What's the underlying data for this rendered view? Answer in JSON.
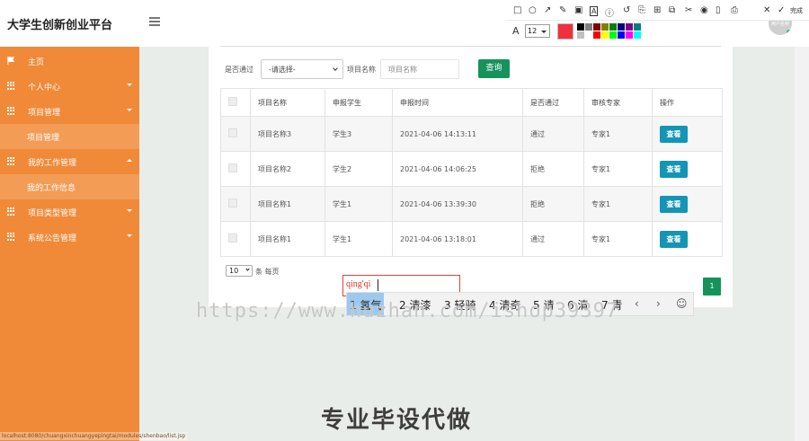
{
  "brand": "大学生创新创业平台",
  "status_url": "localhost:8080/chuangxinchuangyepingtai/modules/shenbao/list.jsp",
  "avatar_text": "用户名称",
  "sidebar": {
    "items": [
      {
        "label": "主页",
        "icon": "flag-icon"
      },
      {
        "label": "个人中心",
        "icon": "grid-icon"
      },
      {
        "label": "项目管理",
        "icon": "grid-icon"
      },
      {
        "label": "项目管理",
        "icon": "none"
      },
      {
        "label": "我的工作管理",
        "icon": "grid-icon"
      },
      {
        "label": "我的工作信息",
        "icon": "none"
      },
      {
        "label": "项目类型管理",
        "icon": "grid-icon"
      },
      {
        "label": "系统公告管理",
        "icon": "grid-icon"
      }
    ]
  },
  "filter": {
    "passed_label": "是否通过",
    "passed_value": "-请选择-",
    "name_label": "项目名称",
    "name_placeholder": "项目名称",
    "query_label": "查询"
  },
  "table": {
    "headers": [
      "",
      "项目名称",
      "申报学生",
      "申报时间",
      "是否通过",
      "审核专家",
      "操作"
    ],
    "rows": [
      {
        "name": "项目名称3",
        "student": "学生3",
        "time": "2021-04-06 14:13:11",
        "passed": "通过",
        "expert": "专家1",
        "action": "查看"
      },
      {
        "name": "项目名称2",
        "student": "学生2",
        "time": "2021-04-06 14:06:25",
        "passed": "拒绝",
        "expert": "专家1",
        "action": "查看"
      },
      {
        "name": "项目名称1",
        "student": "学生1",
        "time": "2021-04-06 13:39:30",
        "passed": "拒绝",
        "expert": "专家1",
        "action": "查看"
      },
      {
        "name": "项目名称1",
        "student": "学生1",
        "time": "2021-04-06 13:18:01",
        "passed": "通过",
        "expert": "专家1",
        "action": "查看"
      }
    ]
  },
  "pagination": {
    "per_page_value": "10",
    "per_page_label": "条 每页",
    "current_page": "1"
  },
  "annotation_toolbar": {
    "done_label": "完成",
    "font_letter": "A",
    "font_size": "12",
    "current_color": "#f0313c",
    "swatches": [
      "#000000",
      "#808080",
      "#800000",
      "#808000",
      "#008000",
      "#000080",
      "#800080",
      "#008080",
      "#c0c0c0",
      "#ffffff",
      "#ff0000",
      "#ffff00",
      "#00ff00",
      "#0000ff",
      "#ff00ff",
      "#00ffff"
    ]
  },
  "ime": {
    "composition": "qing'qi",
    "candidates": [
      "1 氢气",
      "2 清漆",
      "3 轻骑",
      "4 清奇",
      "5 请",
      "6 清",
      "7 青"
    ]
  },
  "watermark": {
    "url": "https://www.huzhan.com/ishop39397",
    "slogan": "专业毕设代做"
  }
}
